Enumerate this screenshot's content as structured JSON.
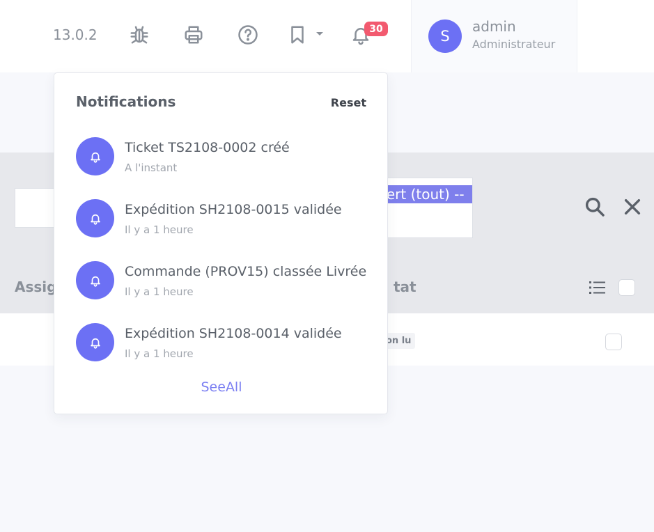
{
  "topbar": {
    "version": "13.0.2",
    "icons": [
      "bug-icon",
      "printer-icon",
      "help-icon",
      "bookmark-icon",
      "bell-icon"
    ],
    "notification_count": "30",
    "user": {
      "initial": "S",
      "name": "admin",
      "role": "Administrateur"
    }
  },
  "filters": {
    "status_select_selected": "vert (tout) --"
  },
  "table": {
    "columns": [
      "Assig",
      "tat"
    ],
    "row": {
      "status": "on lu"
    }
  },
  "notifications": {
    "title": "Notifications",
    "reset_label": "Reset",
    "items": [
      {
        "title": "Ticket TS2108-0002 créé",
        "time": "A l'instant"
      },
      {
        "title": "Expédition SH2108-0015 validée",
        "time": "Il y a 1 heure"
      },
      {
        "title": "Commande (PROV15) classée Livrée",
        "time": "Il y a 1 heure"
      },
      {
        "title": "Expédition SH2108-0014 validée",
        "time": "Il y a 1 heure"
      }
    ],
    "see_all_label": "SeeAll"
  },
  "colors": {
    "accent": "#6c70f4",
    "badge": "#f25a6f",
    "highlight": "#7e7fec"
  }
}
